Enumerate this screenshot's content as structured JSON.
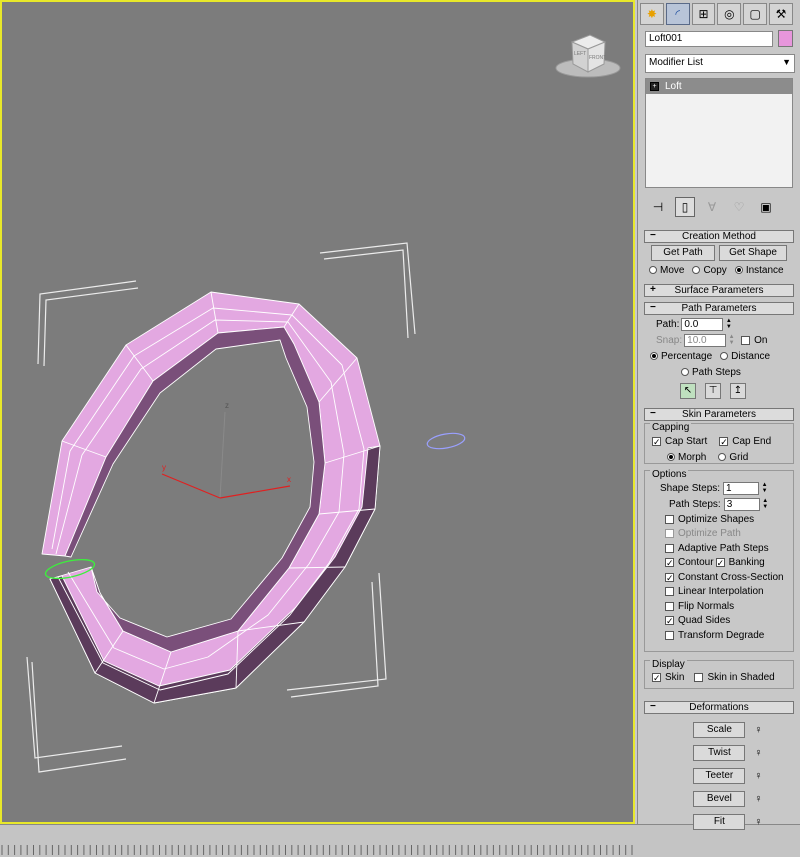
{
  "command_panel": {
    "tabs": [
      {
        "icon": "create-icon",
        "glyph": "✸"
      },
      {
        "icon": "modify-icon",
        "glyph": "◜"
      },
      {
        "icon": "hierarchy-icon",
        "glyph": "⊞"
      },
      {
        "icon": "motion-icon",
        "glyph": "◎"
      },
      {
        "icon": "display-icon",
        "glyph": "▢"
      },
      {
        "icon": "utilities-icon",
        "glyph": "⚒"
      }
    ],
    "object_name": "Loft001",
    "object_color": "#e796dc",
    "modifier_list": "Modifier List",
    "stack_item": "Loft",
    "stack_item_toggle": "+"
  },
  "creation_method": {
    "title": "Creation Method",
    "toggle": "−",
    "get_path": "Get Path",
    "get_shape": "Get Shape",
    "move": "Move",
    "copy": "Copy",
    "instance": "Instance",
    "selected": "Instance"
  },
  "surface_parameters": {
    "title": "Surface Parameters",
    "toggle": "+"
  },
  "path_parameters": {
    "title": "Path Parameters",
    "toggle": "−",
    "path_label": "Path:",
    "path_value": "0.0",
    "snap_label": "Snap:",
    "snap_value": "10.0",
    "on_label": "On",
    "percentage": "Percentage",
    "distance": "Distance",
    "path_steps": "Path Steps",
    "selected": "Percentage"
  },
  "skin_parameters": {
    "title": "Skin Parameters",
    "toggle": "−",
    "capping_title": "Capping",
    "cap_start": "Cap Start",
    "cap_end": "Cap End",
    "morph": "Morph",
    "grid": "Grid",
    "options_title": "Options",
    "shape_steps_label": "Shape Steps:",
    "shape_steps_value": "1",
    "path_steps_label": "Path Steps:",
    "path_steps_value": "3",
    "optimize_shapes": "Optimize Shapes",
    "optimize_path": "Optimize Path",
    "adaptive_path_steps": "Adaptive Path Steps",
    "contour": "Contour",
    "banking": "Banking",
    "constant_cross_section": "Constant Cross-Section",
    "linear_interpolation": "Linear Interpolation",
    "flip_normals": "Flip Normals",
    "quad_sides": "Quad Sides",
    "transform_degrade": "Transform Degrade",
    "display_title": "Display",
    "skin": "Skin",
    "skin_in_shaded": "Skin in Shaded"
  },
  "deformations": {
    "title": "Deformations",
    "toggle": "−",
    "scale": "Scale",
    "twist": "Twist",
    "teeter": "Teeter",
    "bevel": "Bevel",
    "fit": "Fit"
  },
  "viewcube": {
    "front": "FRONT",
    "left": "LEFT"
  },
  "gizmo": {
    "x": "x",
    "y": "y",
    "z": "z"
  },
  "colors": {
    "viewport_bg": "#7c7c7c",
    "active_border": "#e8e82a",
    "loft_color": "#e796dc",
    "panel_bg": "#c8c8c8"
  }
}
